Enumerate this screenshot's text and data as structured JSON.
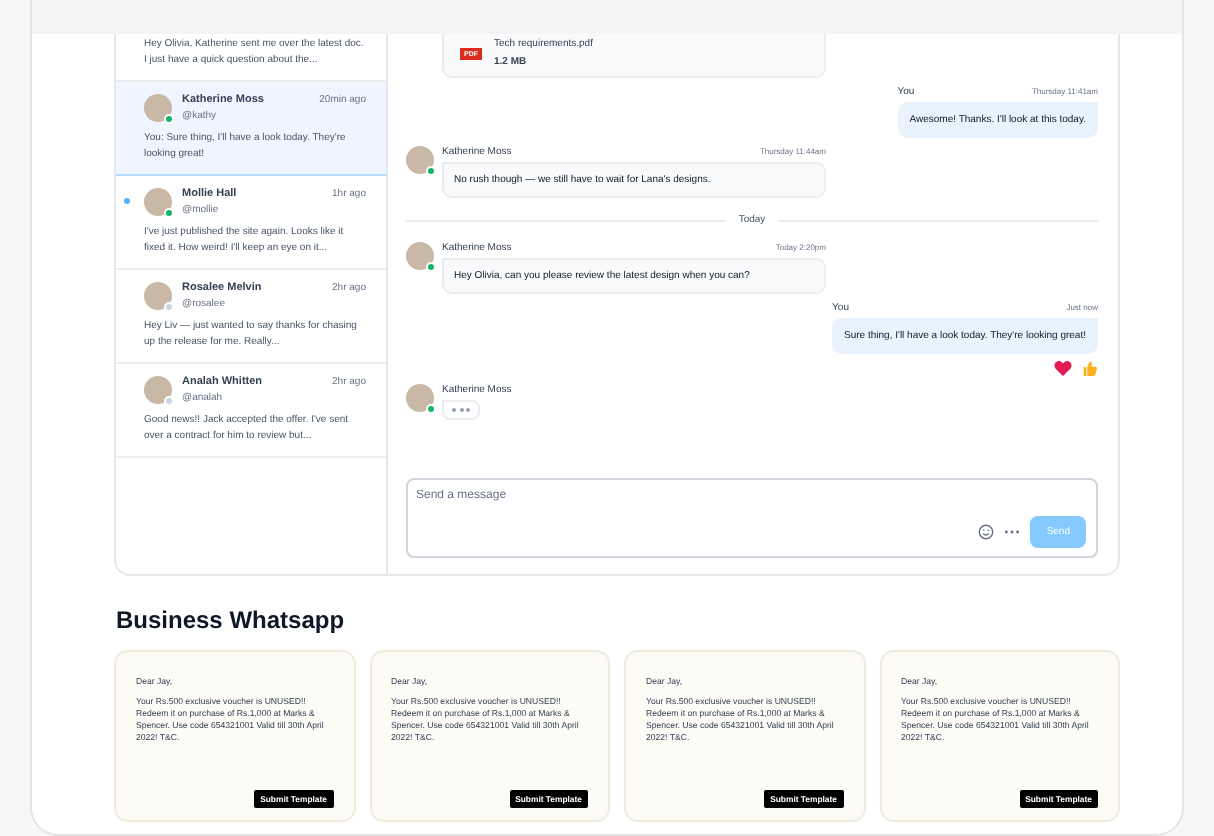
{
  "conversations": [
    {
      "preview": "Hey Olivia, Katherine sent me over the latest doc. I just have a quick question about the...",
      "selected": false,
      "unread": false
    },
    {
      "name": "Katherine Moss",
      "handle": "@kathy",
      "time": "20min ago",
      "preview": "You: Sure thing, I'll have a look today. They're looking great!",
      "online": true,
      "selected": true,
      "unread": false
    },
    {
      "name": "Mollie Hall",
      "handle": "@mollie",
      "time": "1hr ago",
      "preview": "I've just published the site again. Looks like it fixed it. How weird! I'll keep an eye on it...",
      "online": true,
      "selected": false,
      "unread": true
    },
    {
      "name": "Rosalee Melvin",
      "handle": "@rosalee",
      "time": "2hr ago",
      "preview": "Hey Liv — just wanted to say thanks for chasing up the release for me. Really...",
      "online": false,
      "selected": false,
      "unread": false
    },
    {
      "name": "Analah Whitten",
      "handle": "@analah",
      "time": "2hr ago",
      "preview": "Good news!! Jack accepted the offer. I've sent over a contract for him to review but...",
      "online": false,
      "selected": false,
      "unread": false
    }
  ],
  "messages": [
    {
      "kind": "file",
      "file_name": "Tech requirements.pdf",
      "file_type": "PDF",
      "file_size": "1.2 MB"
    },
    {
      "kind": "text",
      "self": true,
      "sender": "You",
      "time": "Thursday 11:41am",
      "text": "Awesome! Thanks. I'll look at this today."
    },
    {
      "kind": "text",
      "self": false,
      "sender": "Katherine Moss",
      "time": "Thursday 11:44am",
      "text": "No rush though — we still have to wait for Lana's designs.",
      "online": true
    },
    {
      "kind": "divider",
      "label": "Today"
    },
    {
      "kind": "text",
      "self": false,
      "sender": "Katherine Moss",
      "time": "Today 2:20pm",
      "text": "Hey Olivia, can you please review the latest design when you can?",
      "online": true
    },
    {
      "kind": "text",
      "self": true,
      "sender": "You",
      "time": "Just now",
      "text": "Sure thing, I'll have a look today. They're looking great!",
      "reacted": true
    },
    {
      "kind": "typing",
      "self": false,
      "sender": "Katherine Moss",
      "online": true
    }
  ],
  "composer": {
    "placeholder": "Send a message",
    "send_label": "Send"
  },
  "business": {
    "title": "Business Whatsapp",
    "templates": [
      {
        "greeting": "Dear Jay,",
        "body": "Your Rs.500 exclusive voucher is UNUSED!! Redeem it on purchase of Rs.1,000 at Marks & Spencer. Use code 654321001 Valid till 30th April 2022! T&C.",
        "button": "Submit Template"
      },
      {
        "greeting": "Dear Jay,",
        "body": "Your Rs.500 exclusive voucher is UNUSED!! Redeem it on purchase of Rs.1,000 at Marks & Spencer. Use code 654321001 Valid till 30th April 2022! T&C.",
        "button": "Submit Template"
      },
      {
        "greeting": "Dear Jay,",
        "body": "Your Rs.500 exclusive voucher is UNUSED!! Redeem it on purchase of Rs.1,000 at Marks & Spencer. Use code 654321001 Valid till 30th April 2022! T&C.",
        "button": "Submit Template"
      },
      {
        "greeting": "Dear Jay,",
        "body": "Your Rs.500 exclusive voucher is UNUSED!! Redeem it on purchase of Rs.1,000 at Marks & Spencer. Use code 654321001 Valid till 30th April 2022! T&C.",
        "button": "Submit Template"
      }
    ]
  }
}
